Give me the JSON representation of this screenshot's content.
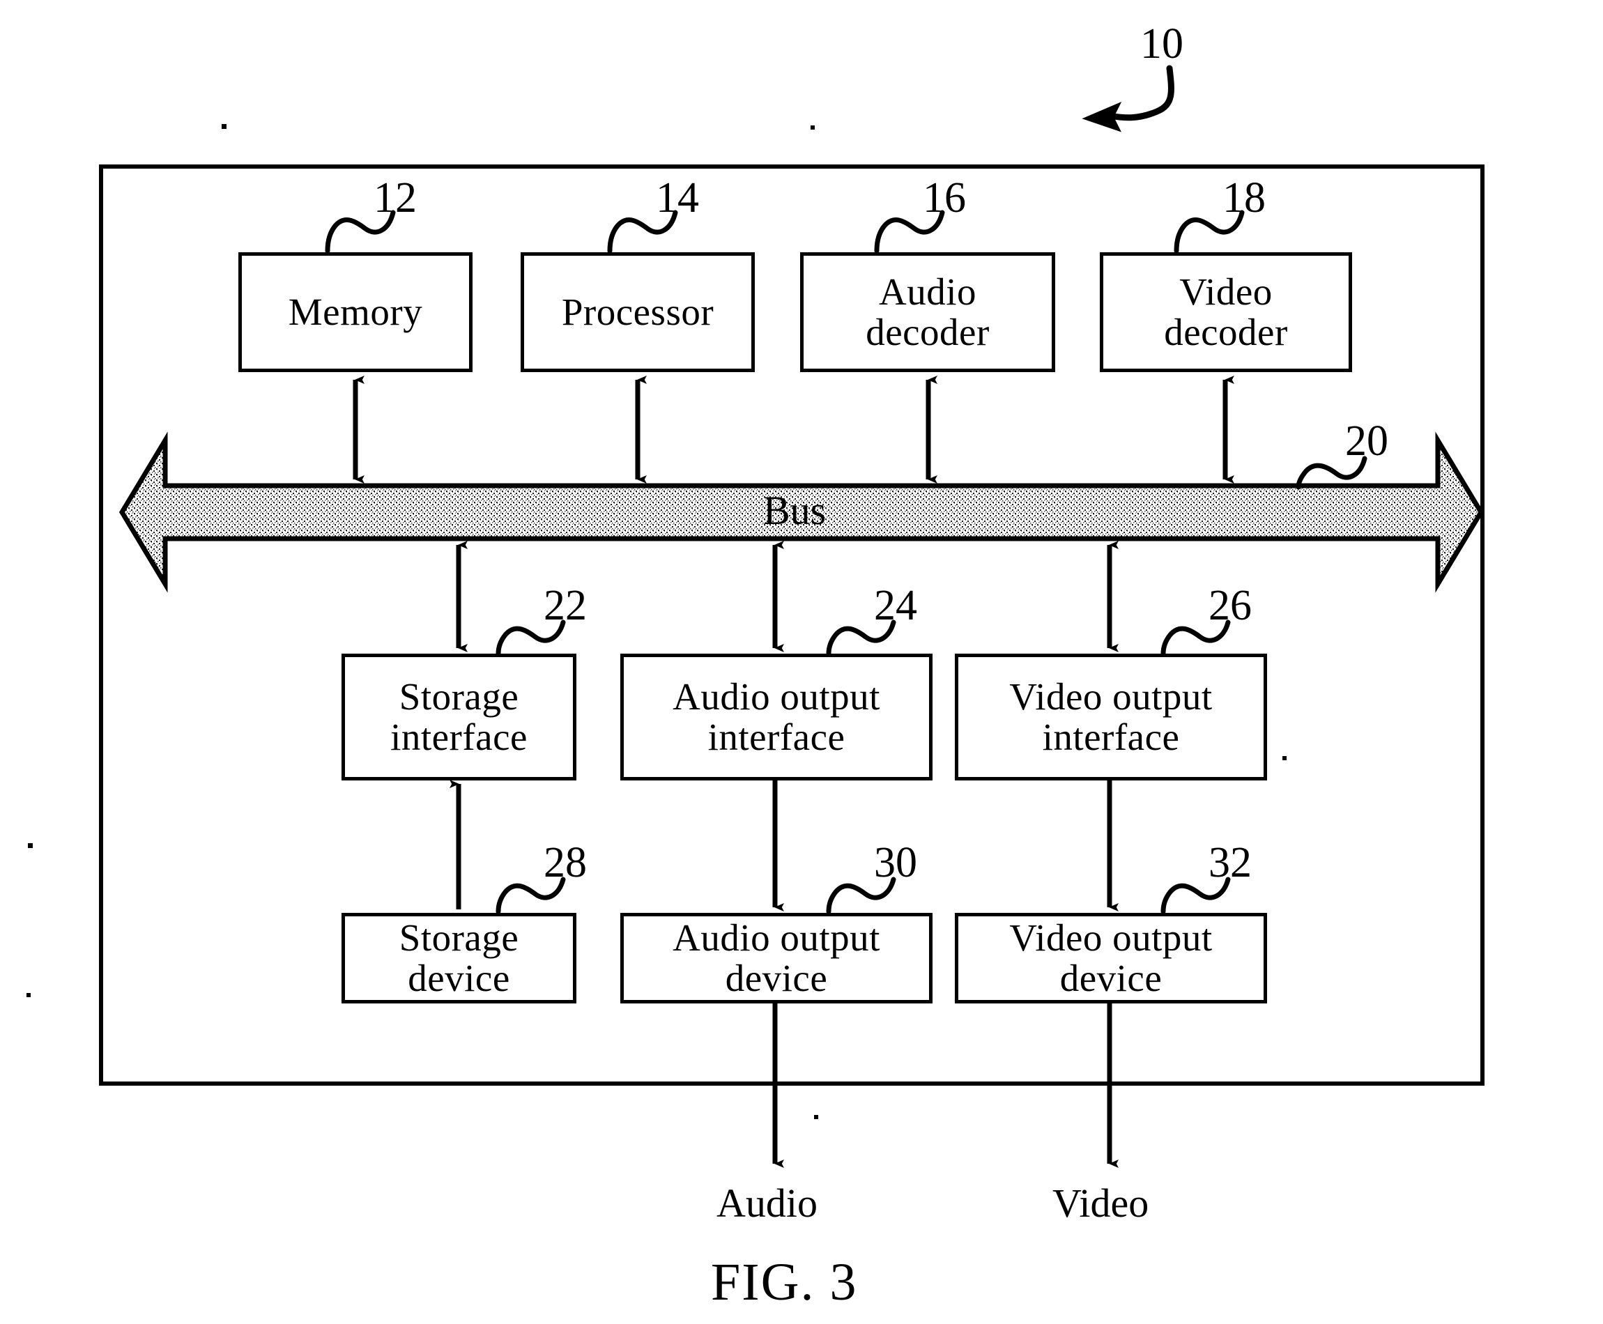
{
  "figure": {
    "caption": "FIG. 3",
    "system_ref": "10"
  },
  "diagram_data": {
    "type": "block-diagram",
    "title": "FIG. 3",
    "system_label": "10",
    "nodes": [
      {
        "id": "memory",
        "label_lines": [
          "Memory"
        ],
        "ref": "12",
        "row": "top"
      },
      {
        "id": "processor",
        "label_lines": [
          "Processor"
        ],
        "ref": "14",
        "row": "top"
      },
      {
        "id": "audio-decoder",
        "label_lines": [
          "Audio",
          "decoder"
        ],
        "ref": "16",
        "row": "top"
      },
      {
        "id": "video-decoder",
        "label_lines": [
          "Video",
          "decoder"
        ],
        "ref": "18",
        "row": "top"
      },
      {
        "id": "bus",
        "label_lines": [
          "Bus"
        ],
        "ref": "20",
        "row": "bus"
      },
      {
        "id": "storage-interface",
        "label_lines": [
          "Storage",
          "interface"
        ],
        "ref": "22",
        "row": "middle"
      },
      {
        "id": "audio-output-interface",
        "label_lines": [
          "Audio output",
          "interface"
        ],
        "ref": "24",
        "row": "middle"
      },
      {
        "id": "video-output-interface",
        "label_lines": [
          "Video output",
          "interface"
        ],
        "ref": "26",
        "row": "middle"
      },
      {
        "id": "storage-device",
        "label_lines": [
          "Storage",
          "device"
        ],
        "ref": "28",
        "row": "bottom"
      },
      {
        "id": "audio-output-device",
        "label_lines": [
          "Audio output",
          "device"
        ],
        "ref": "30",
        "row": "bottom"
      },
      {
        "id": "video-output-device",
        "label_lines": [
          "Video output",
          "device"
        ],
        "ref": "32",
        "row": "bottom"
      }
    ],
    "edges": [
      {
        "from": "memory",
        "to": "bus",
        "arrow": "double"
      },
      {
        "from": "processor",
        "to": "bus",
        "arrow": "double"
      },
      {
        "from": "audio-decoder",
        "to": "bus",
        "arrow": "double"
      },
      {
        "from": "video-decoder",
        "to": "bus",
        "arrow": "double"
      },
      {
        "from": "bus",
        "to": "storage-interface",
        "arrow": "double"
      },
      {
        "from": "bus",
        "to": "audio-output-interface",
        "arrow": "double"
      },
      {
        "from": "bus",
        "to": "video-output-interface",
        "arrow": "double"
      },
      {
        "from": "storage-device",
        "to": "storage-interface",
        "arrow": "single"
      },
      {
        "from": "audio-output-interface",
        "to": "audio-output-device",
        "arrow": "single"
      },
      {
        "from": "video-output-interface",
        "to": "video-output-device",
        "arrow": "single"
      },
      {
        "from": "audio-output-device",
        "to": "audio-out",
        "arrow": "single"
      },
      {
        "from": "video-output-device",
        "to": "video-out",
        "arrow": "single"
      }
    ],
    "external_outputs": [
      {
        "id": "audio-out",
        "label": "Audio"
      },
      {
        "id": "video-out",
        "label": "Video"
      }
    ],
    "bus_style": "double-headed stippled arrow"
  },
  "boxes": {
    "memory": {
      "line1": "Memory",
      "line2": ""
    },
    "processor": {
      "line1": "Processor",
      "line2": ""
    },
    "audio_decoder": {
      "line1": "Audio",
      "line2": "decoder"
    },
    "video_decoder": {
      "line1": "Video",
      "line2": "decoder"
    },
    "storage_interface": {
      "line1": "Storage",
      "line2": "interface"
    },
    "audio_output_interface": {
      "line1": "Audio output",
      "line2": "interface"
    },
    "video_output_interface": {
      "line1": "Video output",
      "line2": "interface"
    },
    "storage_device": {
      "line1": "Storage",
      "line2": "device"
    },
    "audio_output_device": {
      "line1": "Audio output",
      "line2": "device"
    },
    "video_output_device": {
      "line1": "Video output",
      "line2": "device"
    }
  },
  "bus": {
    "label": "Bus",
    "ref": "20"
  },
  "refs": {
    "system": "10",
    "memory": "12",
    "processor": "14",
    "audio_decoder": "16",
    "video_decoder": "18",
    "bus": "20",
    "storage_interface": "22",
    "audio_output_interface": "24",
    "video_output_interface": "26",
    "storage_device": "28",
    "audio_output_device": "30",
    "video_output_device": "32"
  },
  "outputs": {
    "audio": "Audio",
    "video": "Video"
  },
  "colors": {
    "ink": "#000000",
    "paper": "#ffffff"
  }
}
